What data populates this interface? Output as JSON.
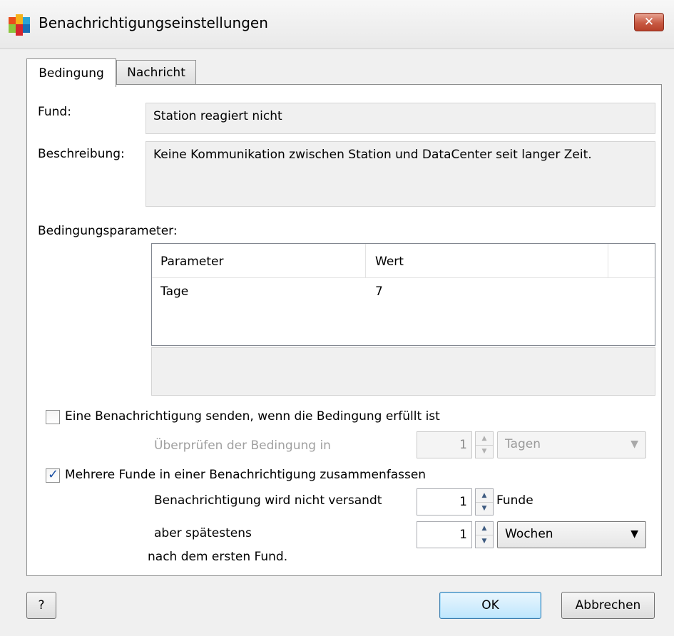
{
  "window": {
    "title": "Benachrichtigungseinstellungen",
    "close_label": "✕",
    "app_icon": "avg-logo-icon"
  },
  "tabs": [
    {
      "label": "Bedingung",
      "active": true
    },
    {
      "label": "Nachricht",
      "active": false
    }
  ],
  "fund": {
    "label": "Fund:",
    "value": "Station reagiert nicht"
  },
  "beschreibung": {
    "label": "Beschreibung:",
    "value": "Keine Kommunikation zwischen Station und DataCenter seit langer Zeit."
  },
  "parameters": {
    "label": "Bedingungsparameter:",
    "columns": [
      "Parameter",
      "Wert"
    ],
    "rows": [
      {
        "parameter": "Tage",
        "wert": "7"
      }
    ]
  },
  "send_notification": {
    "label": "Eine Benachrichtigung senden, wenn die Bedingung erfüllt ist",
    "checked": false,
    "check_label": "Überprüfen der Bedingung in",
    "value": "1",
    "unit": "Tagen"
  },
  "combine": {
    "label": "Mehrere Funde in einer Benachrichtigung zusammenfassen",
    "checked": true,
    "not_sent_label": "Benachrichtigung wird nicht versandt",
    "count_value": "1",
    "count_unit": "Funde",
    "latest_label": "aber spätestens",
    "latest_value": "1",
    "latest_unit": "Wochen",
    "after_label": "nach dem ersten Fund."
  },
  "buttons": {
    "help": "?",
    "ok": "OK",
    "cancel": "Abbrechen"
  },
  "colors": {
    "close_button": "#c85a43",
    "check_mark": "#1a4fa3",
    "default_button": "#bee6fd"
  }
}
